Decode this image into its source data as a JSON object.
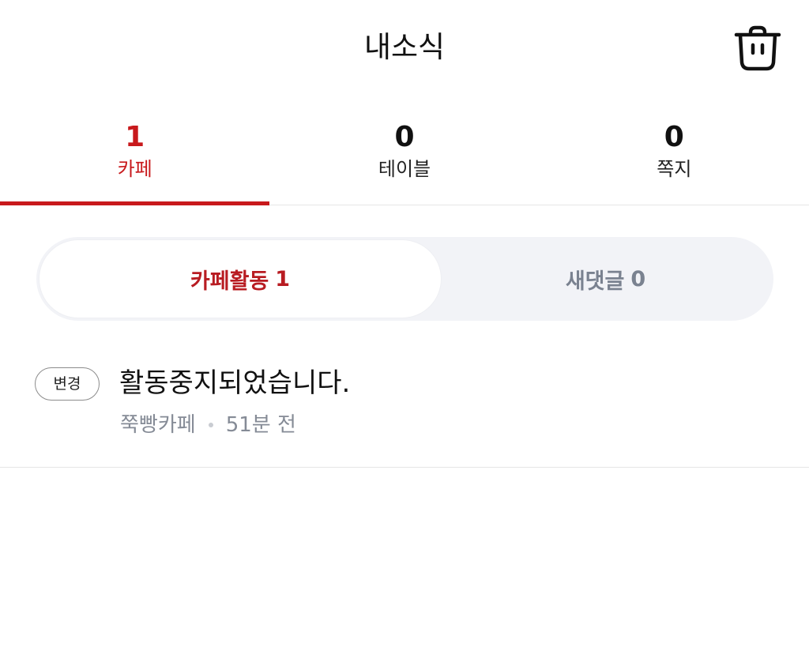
{
  "header": {
    "title": "내소식"
  },
  "icons": {
    "trash": "trash-icon"
  },
  "colors": {
    "accent": "#c8191c",
    "segment_bg": "#f2f3f7",
    "muted_text": "#858b96"
  },
  "tabs": [
    {
      "count": "1",
      "label": "카페",
      "active": true
    },
    {
      "count": "0",
      "label": "테이블",
      "active": false
    },
    {
      "count": "0",
      "label": "쪽지",
      "active": false
    }
  ],
  "segment": {
    "cafe_activity": {
      "label": "카페활동",
      "count": "1"
    },
    "new_comments": {
      "label": "새댓글",
      "count": "0"
    }
  },
  "notifications": [
    {
      "badge": "변경",
      "title": "활동중지되었습니다.",
      "cafe": "쭉빵카페",
      "time": "51분 전"
    }
  ]
}
